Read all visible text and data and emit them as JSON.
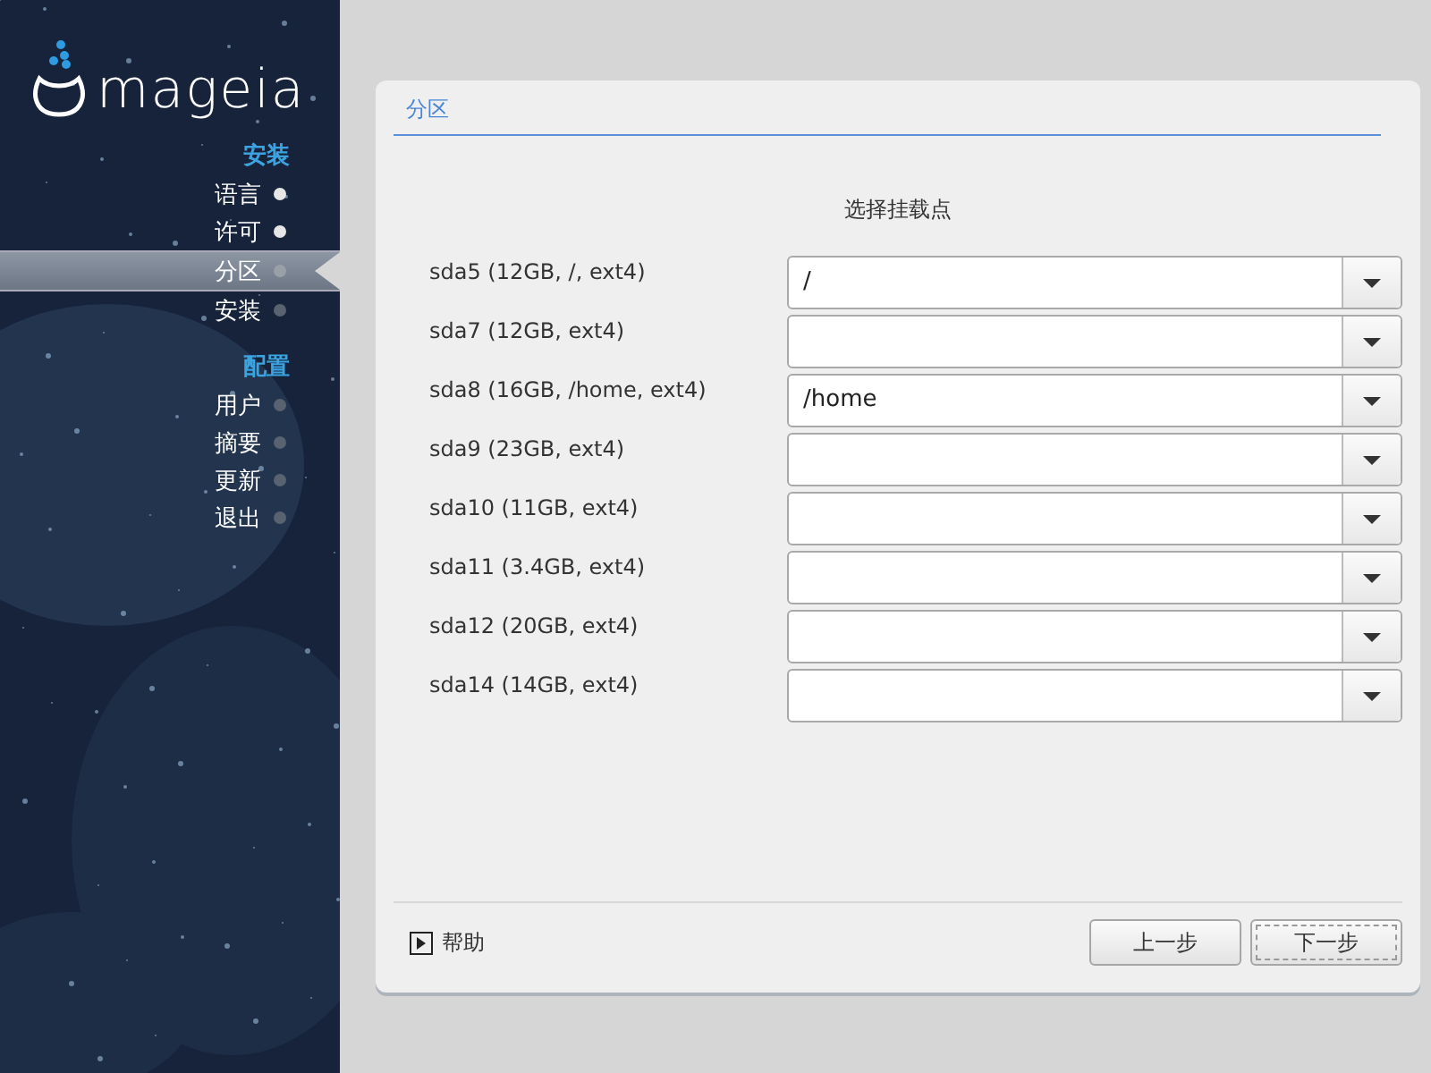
{
  "sidebar": {
    "logo": "mageia",
    "sections": [
      {
        "title": "安装",
        "items": [
          {
            "label": "语言",
            "selected": false,
            "done": true
          },
          {
            "label": "许可",
            "selected": false,
            "done": true
          },
          {
            "label": "分区",
            "selected": true,
            "done": false
          },
          {
            "label": "安装",
            "selected": false,
            "done": false
          }
        ]
      },
      {
        "title": "配置",
        "items": [
          {
            "label": "用户",
            "selected": false,
            "done": false
          },
          {
            "label": "摘要",
            "selected": false,
            "done": false
          },
          {
            "label": "更新",
            "selected": false,
            "done": false
          },
          {
            "label": "退出",
            "selected": false,
            "done": false
          }
        ]
      }
    ]
  },
  "panel": {
    "title": "分区",
    "heading": "选择挂载点",
    "rows": [
      {
        "label": "sda5 (12GB, /, ext4)",
        "value": "/"
      },
      {
        "label": "sda7 (12GB, ext4)"
      },
      {
        "label": "sda8 (16GB, /home, ext4)",
        "value": "/home"
      },
      {
        "label": "sda9 (23GB, ext4)"
      },
      {
        "label": "sda10 (11GB, ext4)"
      },
      {
        "label": "sda11 (3.4GB, ext4)"
      },
      {
        "label": "sda12 (20GB, ext4)"
      },
      {
        "label": "sda14 (14GB, ext4)"
      }
    ],
    "help": "帮助",
    "buttons": [
      {
        "label": "上一步",
        "focused": false
      },
      {
        "label": "下一步",
        "focused": true
      }
    ]
  }
}
